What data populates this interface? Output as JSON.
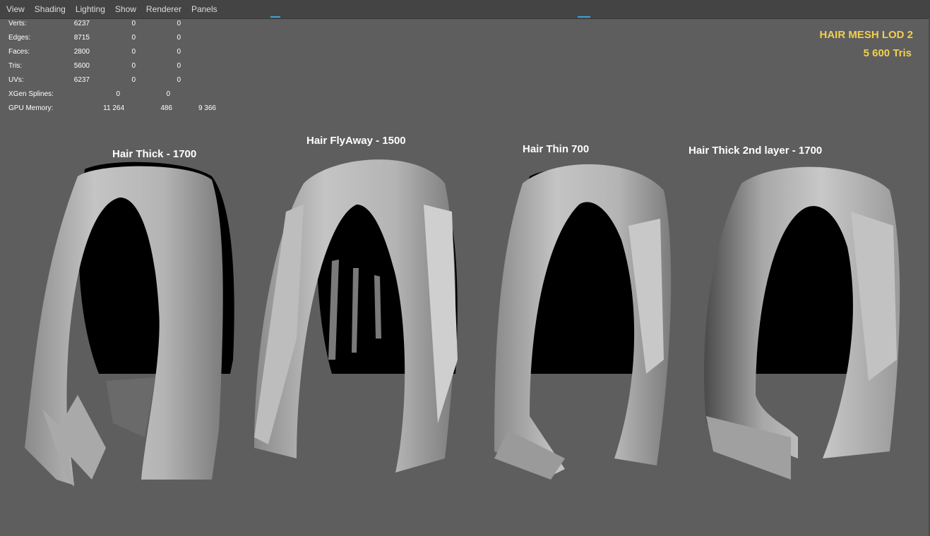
{
  "menu": {
    "items": [
      {
        "label": "View"
      },
      {
        "label": "Shading"
      },
      {
        "label": "Lighting"
      },
      {
        "label": "Show"
      },
      {
        "label": "Renderer"
      },
      {
        "label": "Panels"
      }
    ]
  },
  "stats": {
    "rows": [
      {
        "label": "Verts:",
        "v1": "6237",
        "v2": "0",
        "v3": "0"
      },
      {
        "label": "Edges:",
        "v1": "8715",
        "v2": "0",
        "v3": "0"
      },
      {
        "label": "Faces:",
        "v1": "2800",
        "v2": "0",
        "v3": "0"
      },
      {
        "label": "Tris:",
        "v1": "5600",
        "v2": "0",
        "v3": "0"
      },
      {
        "label": "UVs:",
        "v1": "6237",
        "v2": "0",
        "v3": "0"
      },
      {
        "label": "XGen Splines:",
        "v1": "0",
        "v2": "0"
      },
      {
        "label": "GPU Memory:",
        "v1": "11 264",
        "v2": "486",
        "v3": "9 366"
      }
    ]
  },
  "hud": {
    "title": "HAIR MESH LOD 2",
    "subtitle": "5 600 Tris"
  },
  "meshes": [
    {
      "label": "Hair Thick - 1700"
    },
    {
      "label": "Hair FlyAway - 1500"
    },
    {
      "label": "Hair Thin 700"
    },
    {
      "label": "Hair Thick 2nd layer - 1700"
    }
  ],
  "colors": {
    "viewport_bg": "#5e5e5e",
    "menubar_bg": "#444444",
    "hud_text": "#f2cf52",
    "label_text": "#ffffff",
    "mesh_light": "#c9c9c9",
    "mesh_shadow": "#000000"
  }
}
